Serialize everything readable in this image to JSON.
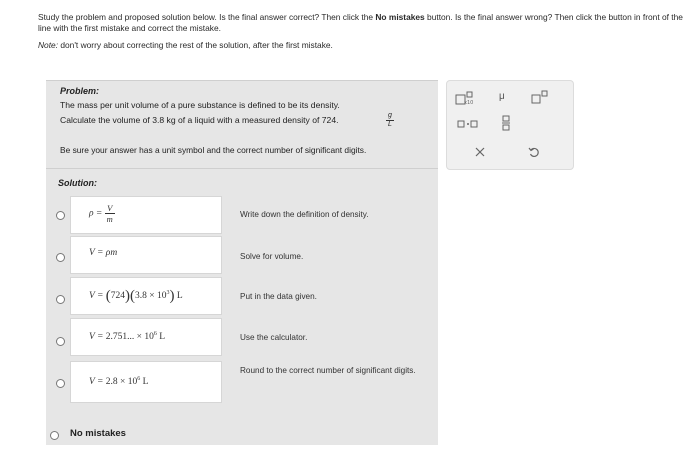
{
  "intro": {
    "part1": "Study the problem and proposed solution below. Is the final answer correct? Then click the ",
    "bold": "No mistakes",
    "part2": " button. Is the final answer wrong? Then click the button in front of the line with the first mistake and correct the mistake.",
    "note_label": "Note:",
    "note_text": " don't worry about correcting the rest of the solution, after the first mistake."
  },
  "problem": {
    "title": "Problem:",
    "line1": "The mass per unit volume of a pure substance is defined to be its density.",
    "line2": "Calculate the volume of 3.8 kg of a liquid with a measured density of 724.",
    "unit_num": "g",
    "unit_den": "L",
    "line3": "Be sure your answer has a unit symbol and the correct number of significant digits."
  },
  "solution": {
    "title": "Solution:",
    "steps": [
      {
        "note": "Write down the definition of density."
      },
      {
        "note": "Solve for volume."
      },
      {
        "note": "Put in the data given."
      },
      {
        "note": "Use the calculator."
      },
      {
        "note": "Round to the correct number of significant digits."
      }
    ]
  },
  "no_mistakes_label": "No mistakes",
  "toolbar": {
    "icons": [
      "superscript-icon",
      "mu-icon",
      "exponent-icon",
      "times-dot-icon",
      "fraction-icon",
      "clear-icon",
      "undo-icon"
    ],
    "mu": "μ"
  }
}
